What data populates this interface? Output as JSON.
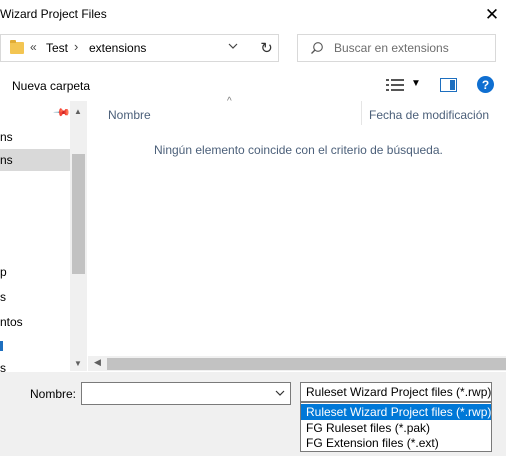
{
  "window": {
    "title": "Wizard Project Files"
  },
  "address": {
    "chevrons": "«",
    "crumbs": [
      "Test",
      "extensions"
    ],
    "separator": "›"
  },
  "search": {
    "placeholder": "Buscar en extensions"
  },
  "toolbar": {
    "new_folder": "Nueva carpeta",
    "help": "?"
  },
  "nav": {
    "items": [
      "ns",
      "ns",
      "p",
      "s",
      "ntos",
      "",
      "s"
    ]
  },
  "columns": {
    "name": "Nombre",
    "date": "Fecha de modificación"
  },
  "file_list": {
    "empty_message": "Ningún elemento coincide con el criterio de búsqueda."
  },
  "bottom": {
    "name_label": "Nombre:",
    "name_value": "",
    "type_selected": "Ruleset Wizard Project files (*.rwp)",
    "type_options": [
      "Ruleset Wizard Project files (*.rwp)",
      "FG Ruleset files (*.pak)",
      "FG Extension files (*.ext)"
    ]
  },
  "colors": {
    "accent": "#0078d7",
    "help": "#0f6fd1",
    "folder": "#f3c552"
  },
  "icons": [
    "folder-icon",
    "refresh-icon",
    "search-icon",
    "views-icon",
    "preview-pane-icon",
    "help-icon",
    "pin-icon",
    "close-icon"
  ]
}
